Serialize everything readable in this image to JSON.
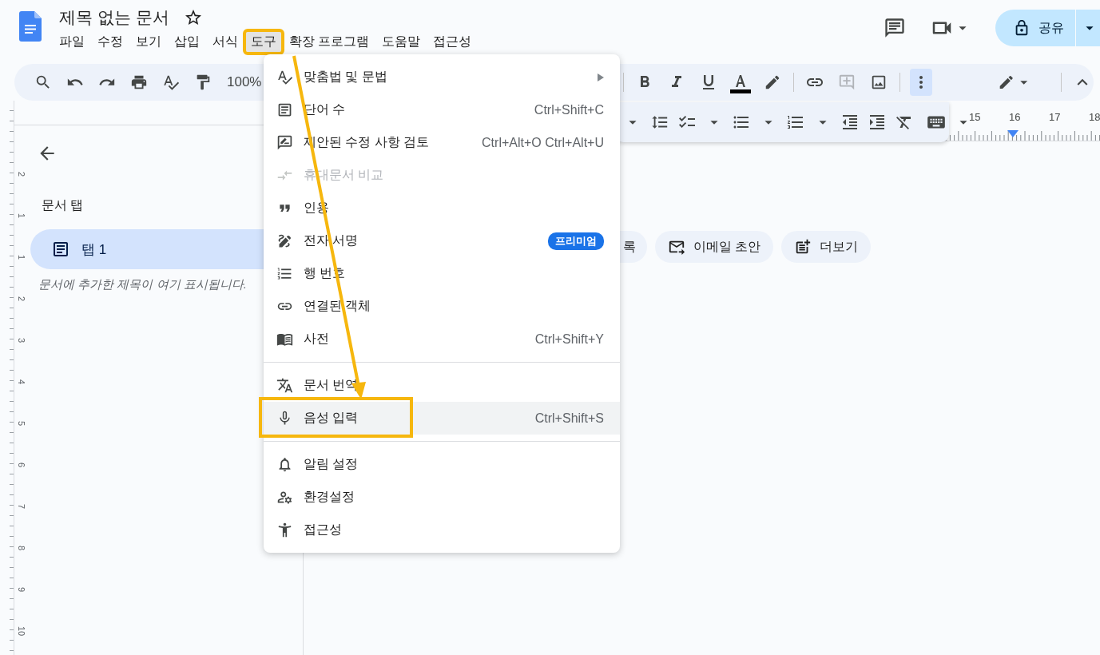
{
  "document": {
    "title": "제목 없는 문서",
    "starred": false
  },
  "menu_bar": [
    {
      "label": "파일",
      "selected": false
    },
    {
      "label": "수정",
      "selected": false
    },
    {
      "label": "보기",
      "selected": false
    },
    {
      "label": "삽입",
      "selected": false
    },
    {
      "label": "서식",
      "selected": false
    },
    {
      "label": "도구",
      "selected": true
    },
    {
      "label": "확장 프로그램",
      "selected": false
    },
    {
      "label": "도움말",
      "selected": false
    },
    {
      "label": "접근성",
      "selected": false
    }
  ],
  "share_button": {
    "label": "공유"
  },
  "toolbar": {
    "zoom": "100%",
    "more_active": true
  },
  "ruler": {
    "labels": [
      "15",
      "16",
      "17",
      "18"
    ]
  },
  "vertical_ruler": {
    "labels": [
      "2",
      "1",
      "1",
      "2",
      "3",
      "4",
      "5",
      "6",
      "7",
      "8",
      "9",
      "10"
    ]
  },
  "sidebar": {
    "heading": "문서 탭",
    "tabs": [
      {
        "label": "탭 1",
        "selected": true
      }
    ],
    "hint": "문서에 추가한 제목이 여기 표시됩니다."
  },
  "chips": [
    {
      "label": "록"
    },
    {
      "label": "이메일 초안"
    },
    {
      "label": "더보기"
    }
  ],
  "tools_menu": {
    "groups": [
      {
        "items": [
          {
            "label": "맞춤법 및 문법",
            "kind": "submenu",
            "disabled": false,
            "highlighted": false
          },
          {
            "label": "단어 수",
            "kind": "shortcut",
            "shortcut": "Ctrl+Shift+C",
            "disabled": false,
            "highlighted": false
          },
          {
            "label": "제안된 수정 사항 검토",
            "kind": "shortcut",
            "shortcut": "Ctrl+Alt+O Ctrl+Alt+U",
            "disabled": false,
            "highlighted": false
          },
          {
            "label": "휴대문서 비교",
            "kind": "plain",
            "disabled": true,
            "highlighted": false
          },
          {
            "label": "인용",
            "kind": "plain",
            "disabled": false,
            "highlighted": false
          },
          {
            "label": "전자 서명",
            "kind": "badge",
            "badge": "프리미엄",
            "disabled": false,
            "highlighted": false
          },
          {
            "label": "행 번호",
            "kind": "plain",
            "disabled": false,
            "highlighted": false
          },
          {
            "label": "연결된 객체",
            "kind": "plain",
            "disabled": false,
            "highlighted": false
          },
          {
            "label": "사전",
            "kind": "shortcut",
            "shortcut": "Ctrl+Shift+Y",
            "disabled": false,
            "highlighted": false
          }
        ]
      },
      {
        "items": [
          {
            "label": "문서 번역",
            "kind": "plain",
            "disabled": false,
            "highlighted": false
          },
          {
            "label": "음성 입력",
            "kind": "shortcut",
            "shortcut": "Ctrl+Shift+S",
            "disabled": false,
            "highlighted": true
          }
        ]
      },
      {
        "items": [
          {
            "label": "알림 설정",
            "kind": "plain",
            "disabled": false,
            "highlighted": false
          },
          {
            "label": "환경설정",
            "kind": "plain",
            "disabled": false,
            "highlighted": false
          },
          {
            "label": "접근성",
            "kind": "plain",
            "disabled": false,
            "highlighted": false
          }
        ]
      }
    ]
  }
}
